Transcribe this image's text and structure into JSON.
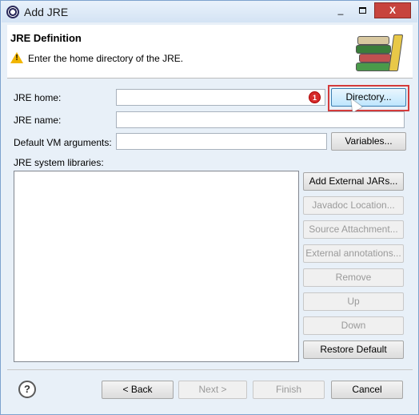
{
  "window": {
    "title": "Add JRE",
    "controls": {
      "minimize": "_",
      "close": "X"
    }
  },
  "banner": {
    "title": "JRE Definition",
    "message": "Enter the home directory of the JRE.",
    "warning_icon": "warning-triangle",
    "image": "books-library-icon"
  },
  "form": {
    "jre_home_label": "JRE home:",
    "jre_home_value": "",
    "directory_button": "Directory...",
    "jre_name_label": "JRE name:",
    "jre_name_value": "",
    "vm_args_label": "Default VM arguments:",
    "vm_args_value": "",
    "variables_button": "Variables...",
    "libraries_label": "JRE system libraries:"
  },
  "library_buttons": [
    {
      "label": "Add External JARs...",
      "enabled": true
    },
    {
      "label": "Javadoc Location...",
      "enabled": false
    },
    {
      "label": "Source Attachment...",
      "enabled": false
    },
    {
      "label": "External annotations...",
      "enabled": false
    },
    {
      "label": "Remove",
      "enabled": false
    },
    {
      "label": "Up",
      "enabled": false
    },
    {
      "label": "Down",
      "enabled": false
    },
    {
      "label": "Restore Default",
      "enabled": true
    }
  ],
  "annotation": {
    "step_badge": "1",
    "highlight_color": "#d43b3b"
  },
  "footer": {
    "help": "?",
    "back": "< Back",
    "next": "Next >",
    "finish": "Finish",
    "cancel": "Cancel"
  }
}
